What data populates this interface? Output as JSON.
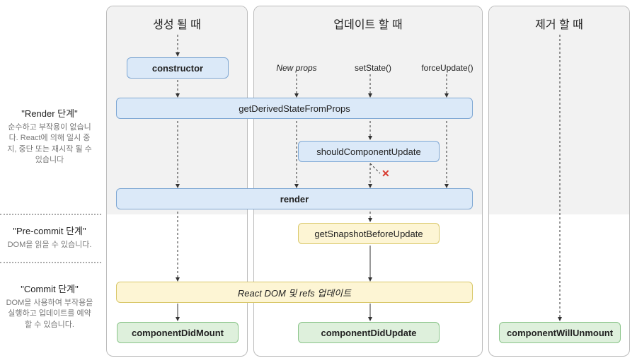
{
  "sidebar": {
    "render": {
      "title": "\"Render 단계\"",
      "desc": "순수하고 부작용이 없습니다. React에 의해 일시 중지, 중단 또는 재시작 될 수 있습니다"
    },
    "precommit": {
      "title": "\"Pre-commit 단계\"",
      "desc": "DOM을 읽을 수 있습니다."
    },
    "commit": {
      "title": "\"Commit 단계\"",
      "desc": "DOM을 사용하여 부작용을 실행하고 업데이트를 예약 할 수 있습니다."
    }
  },
  "cols": {
    "mount": {
      "title": "생성 될 때"
    },
    "update": {
      "title": "업데이트 할 때"
    },
    "unmount": {
      "title": "제거 할 때"
    }
  },
  "boxes": {
    "constructor": "constructor",
    "gdsfp": "getDerivedStateFromProps",
    "scu": "shouldComponentUpdate",
    "render": "render",
    "gsbu": "getSnapshotBeforeUpdate",
    "react_dom_refs": "React DOM 및 refs 업데이트",
    "cdm": "componentDidMount",
    "cdu": "componentDidUpdate",
    "cwu": "componentWillUnmount"
  },
  "triggers": {
    "new_props": "New props",
    "set_state": "setState()",
    "force_update": "forceUpdate()"
  },
  "x": "✕"
}
